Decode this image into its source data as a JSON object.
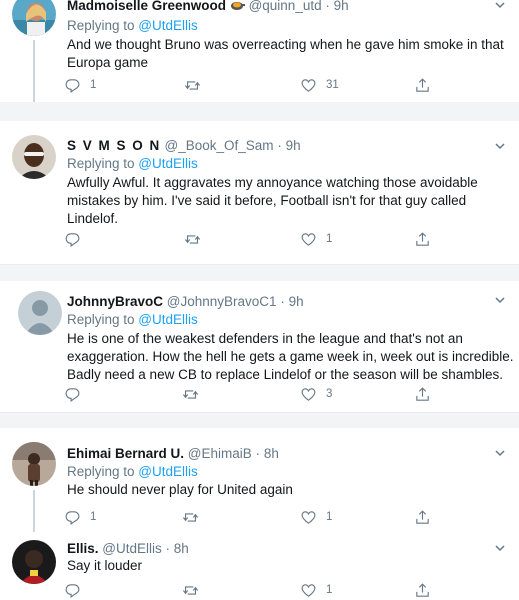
{
  "tweets": [
    {
      "name": "Madmoiselle Greenwood",
      "handle": "@quinn_utd",
      "dot": "·",
      "time": "9h",
      "replying_prefix": "Replying to ",
      "replying_to": "@UtdEllis",
      "text": "And we thought Bruno was overreacting when he gave him smoke in that Europa game",
      "replies": "1",
      "retweets": "",
      "likes": "31"
    },
    {
      "name": "S V M S O N",
      "handle": "@_Book_Of_Sam",
      "dot": "·",
      "time": "9h",
      "replying_prefix": "Replying to ",
      "replying_to": "@UtdEllis",
      "text": "Awfully Awful. It aggravates my annoyance watching those avoidable mistakes by him. I've said it before, Football isn't for that guy called Lindelof.",
      "replies": "",
      "retweets": "",
      "likes": "1"
    },
    {
      "name": "JohnnyBravoC",
      "handle": "@JohnnyBravoC1",
      "dot": "·",
      "time": "9h",
      "replying_prefix": "Replying to ",
      "replying_to": "@UtdEllis",
      "text": "He is one of the weakest defenders in the league and that's not an exaggeration. How the hell he gets a game week in, week out is incredible. Badly need a new CB to replace Lindelof or the season will be shambles.",
      "replies": "",
      "retweets": "",
      "likes": "3"
    },
    {
      "name": "Ehimai Bernard U.",
      "handle": "@EhimaiB",
      "dot": "·",
      "time": "8h",
      "replying_prefix": "Replying to ",
      "replying_to": "@UtdEllis",
      "text": "He should never play for United again",
      "replies": "1",
      "retweets": "",
      "likes": "1"
    },
    {
      "name": "Ellis.",
      "handle": "@UtdEllis",
      "dot": "·",
      "time": "8h",
      "text": "Say it louder",
      "replies": "",
      "retweets": "",
      "likes": "1"
    }
  ],
  "icons": {
    "reply": "reply-icon",
    "retweet": "retweet-icon",
    "like": "heart-icon",
    "share": "share-icon",
    "more": "chevron-down-icon",
    "emoji": "cooking-emoji-icon"
  },
  "colors": {
    "link": "#1da1f2",
    "secondary_text": "#657786",
    "separator": "#f2f4f6",
    "thread_line": "#ccd6dd"
  }
}
